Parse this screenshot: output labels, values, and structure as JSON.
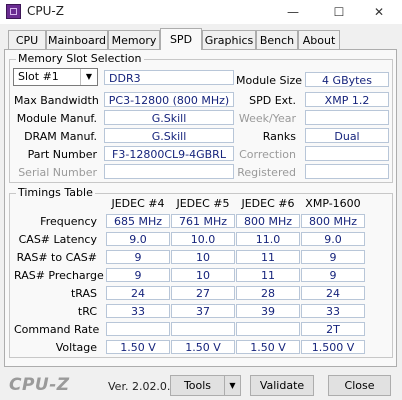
{
  "window": {
    "title": "CPU-Z",
    "min": "—",
    "max": "☐",
    "close": "✕"
  },
  "tabs": [
    "CPU",
    "Mainboard",
    "Memory",
    "SPD",
    "Graphics",
    "Bench",
    "About"
  ],
  "slot_group": {
    "title": "Memory Slot Selection",
    "slot": "Slot #1",
    "type": "DDR3",
    "module_size_label": "Module Size",
    "module_size": "4 GBytes",
    "max_bandwidth_label": "Max Bandwidth",
    "max_bandwidth": "PC3-12800 (800 MHz)",
    "spd_ext_label": "SPD Ext.",
    "spd_ext": "XMP 1.2",
    "module_manuf_label": "Module Manuf.",
    "module_manuf": "G.Skill",
    "week_year_label": "Week/Year",
    "week_year": "",
    "dram_manuf_label": "DRAM Manuf.",
    "dram_manuf": "G.Skill",
    "ranks_label": "Ranks",
    "ranks": "Dual",
    "part_number_label": "Part Number",
    "part_number": "F3-12800CL9-4GBRL",
    "correction_label": "Correction",
    "correction": "",
    "serial_label": "Serial Number",
    "serial": "",
    "registered_label": "Registered",
    "registered": ""
  },
  "timings": {
    "title": "Timings Table",
    "columns": [
      "JEDEC #4",
      "JEDEC #5",
      "JEDEC #6",
      "XMP-1600"
    ],
    "rows": [
      {
        "label": "Frequency",
        "values": [
          "685 MHz",
          "761 MHz",
          "800 MHz",
          "800 MHz"
        ]
      },
      {
        "label": "CAS# Latency",
        "values": [
          "9.0",
          "10.0",
          "11.0",
          "9.0"
        ]
      },
      {
        "label": "RAS# to CAS#",
        "values": [
          "9",
          "10",
          "11",
          "9"
        ]
      },
      {
        "label": "RAS# Precharge",
        "values": [
          "9",
          "10",
          "11",
          "9"
        ]
      },
      {
        "label": "tRAS",
        "values": [
          "24",
          "27",
          "28",
          "24"
        ]
      },
      {
        "label": "tRC",
        "values": [
          "33",
          "37",
          "39",
          "33"
        ]
      },
      {
        "label": "Command Rate",
        "values": [
          "",
          "",
          "",
          "2T"
        ]
      },
      {
        "label": "Voltage",
        "values": [
          "1.50 V",
          "1.50 V",
          "1.50 V",
          "1.500 V"
        ]
      }
    ]
  },
  "footer": {
    "brand": "CPU-Z",
    "version": "Ver. 2.02.0.x64",
    "tools": "Tools",
    "validate": "Validate",
    "close": "Close"
  }
}
